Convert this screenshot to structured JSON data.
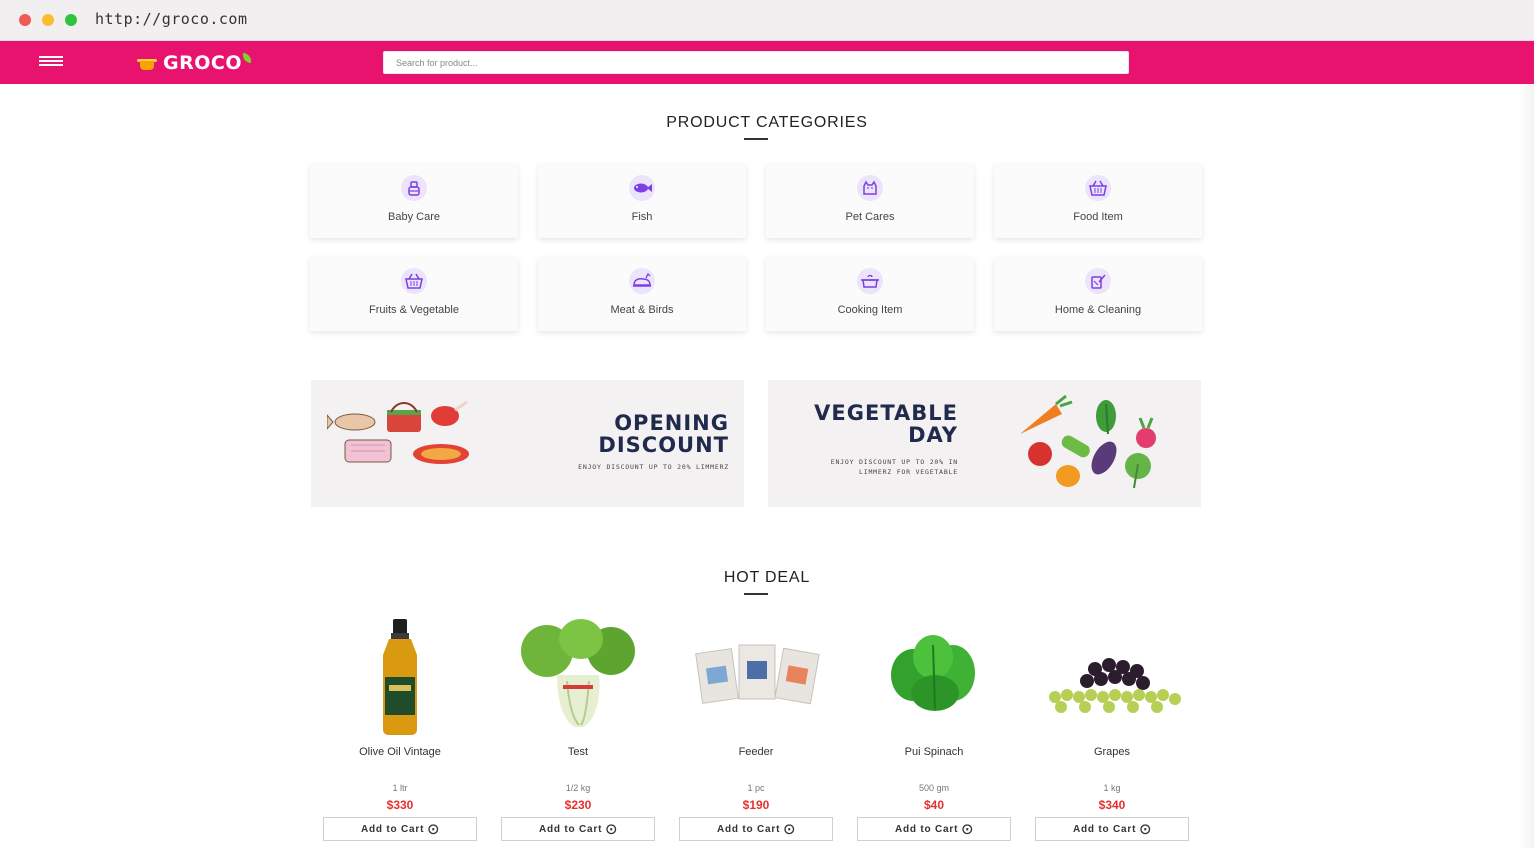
{
  "browser": {
    "url": "http://groco.com"
  },
  "header": {
    "logo_text": "GROCO",
    "search_placeholder": "Search for product..."
  },
  "categories": {
    "title": "PRODUCT CATEGORIES",
    "items": [
      {
        "label": "Baby Care",
        "icon": "baby-care-icon"
      },
      {
        "label": "Fish",
        "icon": "fish-icon"
      },
      {
        "label": "Pet Cares",
        "icon": "pet-icon"
      },
      {
        "label": "Food Item",
        "icon": "basket-icon"
      },
      {
        "label": "Fruits & Vegetable",
        "icon": "basket-icon"
      },
      {
        "label": "Meat & Birds",
        "icon": "chicken-icon"
      },
      {
        "label": "Cooking Item",
        "icon": "cooking-pot-icon"
      },
      {
        "label": "Home & Cleaning",
        "icon": "cleaning-icon"
      }
    ]
  },
  "banners": [
    {
      "title_line1": "OPENING",
      "title_line2": "DISCOUNT",
      "subtitle": "ENJOY DISCOUNT UP TO 20% LIMMERZ"
    },
    {
      "title_line1": "VEGETABLE",
      "title_line2": "DAY",
      "subtitle_line1": "ENJOY DISCOUNT UP TO 20% IN",
      "subtitle_line2": "LIMMERZ FOR VEGETABLE"
    }
  ],
  "hot_deal": {
    "title": "HOT DEAL",
    "cart_label": "Add to Cart",
    "products": [
      {
        "name": "Olive Oil Vintage",
        "qty": "1 ltr",
        "price": "$330"
      },
      {
        "name": "Test",
        "qty": "1/2 kg",
        "price": "$230"
      },
      {
        "name": "Feeder",
        "qty": "1 pc",
        "price": "$190"
      },
      {
        "name": "Pui Spinach",
        "qty": "500 gm",
        "price": "$40"
      },
      {
        "name": "Grapes",
        "qty": "1 kg",
        "price": "$340"
      }
    ]
  },
  "colors": {
    "brand": "#e8136f",
    "price": "#e53030",
    "icon_purple": "#7b3fe4",
    "banner_title": "#1f2a4d"
  }
}
